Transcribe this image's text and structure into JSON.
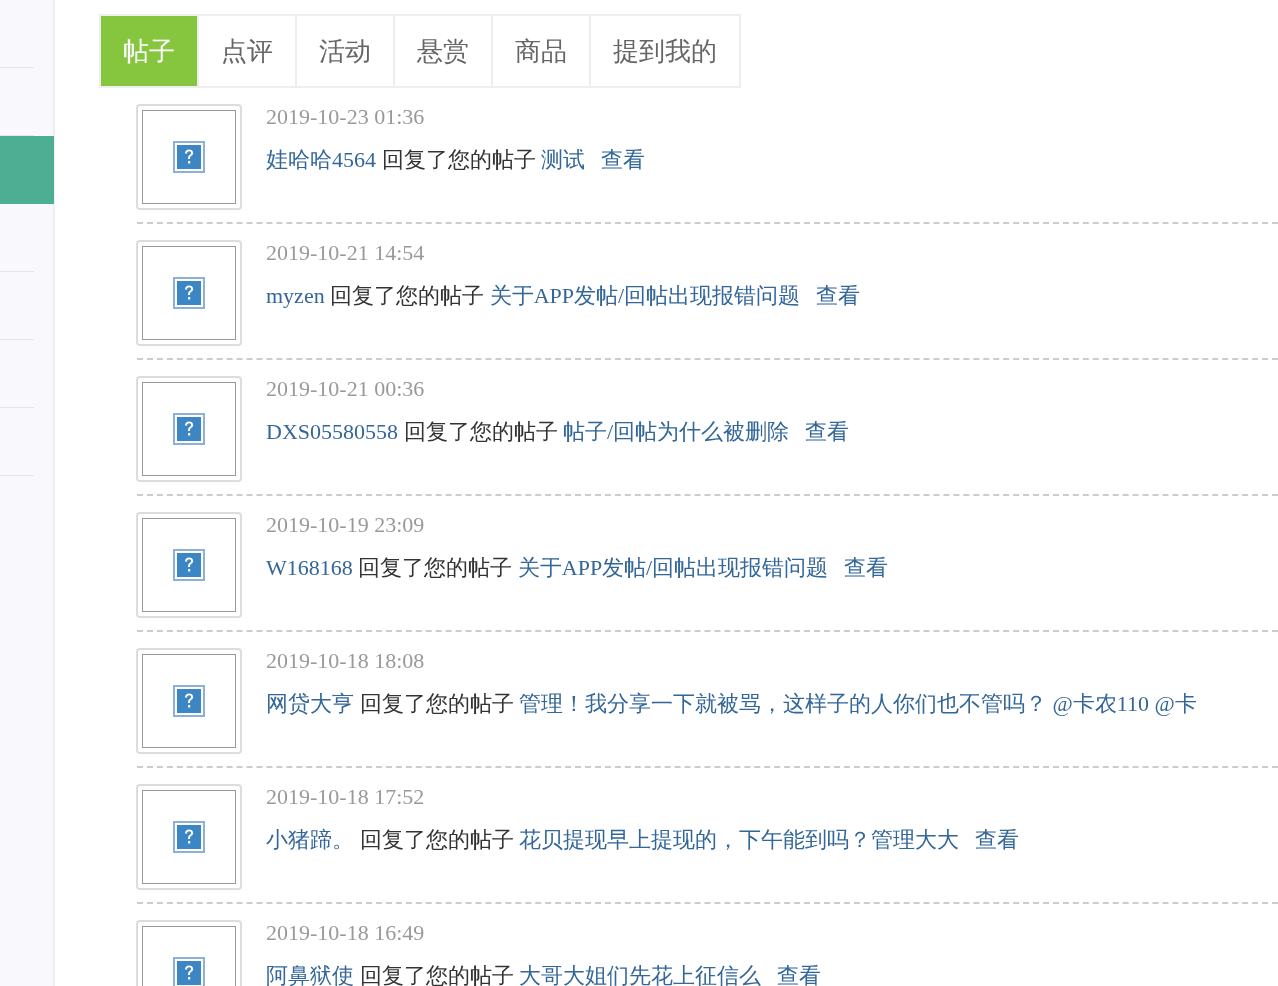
{
  "sidebar": {
    "items": [
      {
        "selected": false
      },
      {
        "selected": false
      },
      {
        "selected": true
      },
      {
        "selected": false
      },
      {
        "selected": false
      },
      {
        "selected": false
      },
      {
        "selected": false
      }
    ]
  },
  "tabs": [
    {
      "label": "帖子",
      "selected": true
    },
    {
      "label": "点评",
      "selected": false
    },
    {
      "label": "活动",
      "selected": false
    },
    {
      "label": "悬赏",
      "selected": false
    },
    {
      "label": "商品",
      "selected": false
    },
    {
      "label": "提到我的",
      "selected": false
    }
  ],
  "notices": [
    {
      "time": "2019-10-23 01:36",
      "user": "娃哈哈4564",
      "action": "回复了您的帖子",
      "title": "测试",
      "view": "查看"
    },
    {
      "time": "2019-10-21 14:54",
      "user": "myzen",
      "action": "回复了您的帖子",
      "title": "关于APP发帖/回帖出现报错问题",
      "view": "查看"
    },
    {
      "time": "2019-10-21 00:36",
      "user": "DXS05580558",
      "action": "回复了您的帖子",
      "title": "帖子/回帖为什么被删除",
      "view": "查看"
    },
    {
      "time": "2019-10-19 23:09",
      "user": "W168168",
      "action": "回复了您的帖子",
      "title": "关于APP发帖/回帖出现报错问题",
      "view": "查看"
    },
    {
      "time": "2019-10-18 18:08",
      "user": "网贷大亨",
      "action": "回复了您的帖子",
      "title": "管理！我分享一下就被骂，这样子的人你们也不管吗？ @卡农110 @卡"
    },
    {
      "time": "2019-10-18 17:52",
      "user": "小猪蹄。",
      "action": "回复了您的帖子",
      "title": "花贝提现早上提现的，下午能到吗？管理大大",
      "view": "查看"
    },
    {
      "time": "2019-10-18 16:49",
      "user": "阿鼻狱使",
      "action": "回复了您的帖子",
      "title": "大哥大姐们先花上征信么",
      "view": "查看"
    }
  ]
}
